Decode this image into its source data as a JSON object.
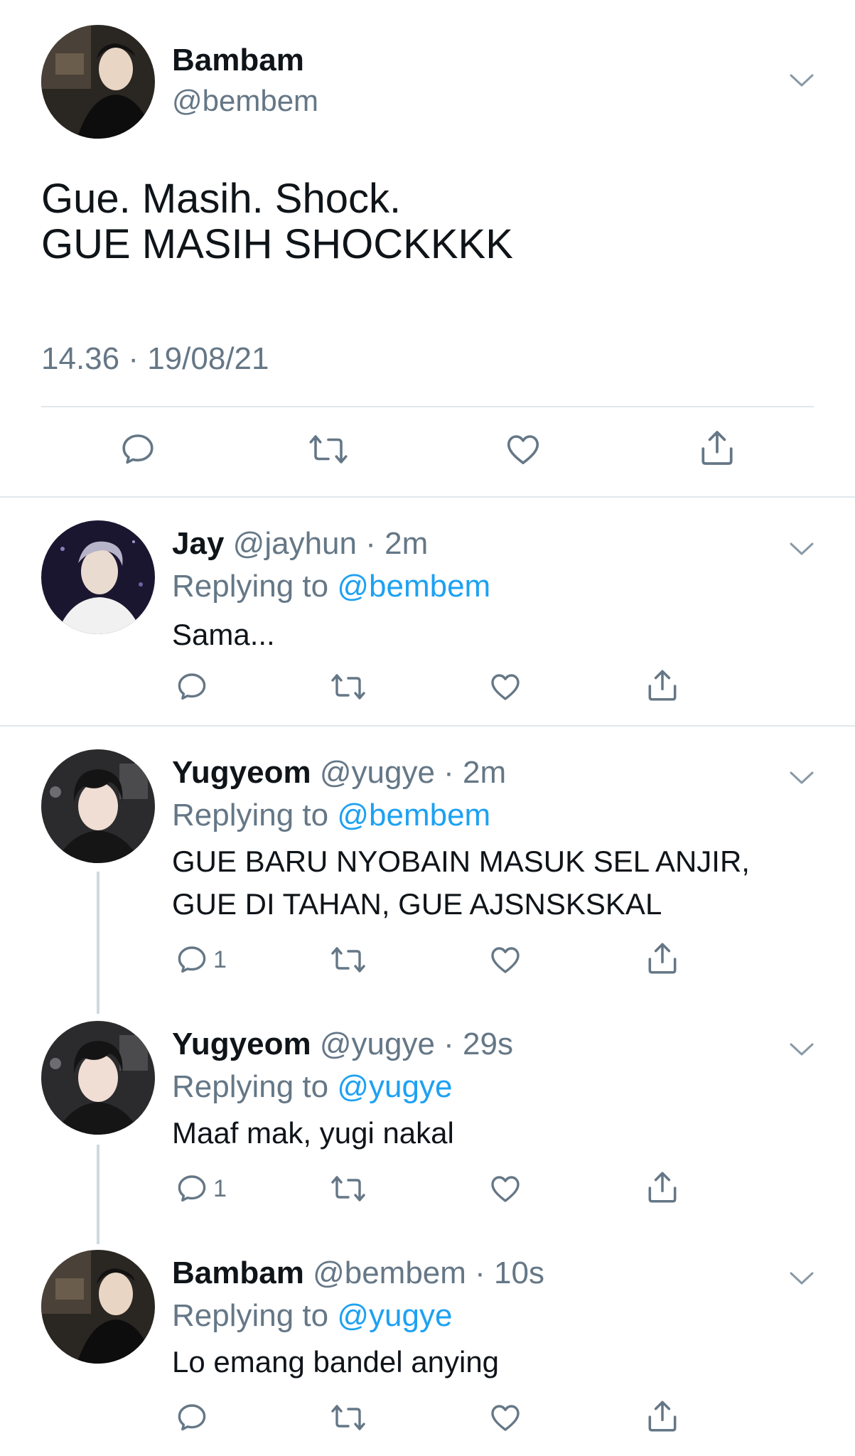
{
  "main_tweet": {
    "name": "Bambam",
    "handle": "@bembem",
    "text_lines": [
      "Gue. Masih. Shock.",
      "GUE MASIH SHOCKKKK"
    ],
    "timestamp": "14.36 · 19/08/21",
    "actions": [
      "reply-icon",
      "retweet-icon",
      "like-icon",
      "share-icon"
    ]
  },
  "replies": [
    {
      "name": "Jay",
      "handle": "@jayhun",
      "time": "· 2m",
      "replying_label": "Replying to ",
      "replying_to": "@bembem",
      "text_lines": [
        "Sama..."
      ],
      "reply_count": ""
    },
    {
      "name": "Yugyeom",
      "handle": "@yugye",
      "time": "· 2m",
      "replying_label": "Replying to ",
      "replying_to": "@bembem",
      "text_lines": [
        "GUE BARU NYOBAIN MASUK SEL ANJIR,",
        "GUE DI TAHAN, GUE AJSNSKSKAL"
      ],
      "reply_count": "1"
    },
    {
      "name": "Yugyeom",
      "handle": "@yugye",
      "time": "· 29s",
      "replying_label": "Replying to ",
      "replying_to": "@yugye",
      "text_lines": [
        "Maaf mak, yugi nakal"
      ],
      "reply_count": "1"
    },
    {
      "name": "Bambam",
      "handle": "@bembem",
      "time": "· 10s",
      "replying_label": "Replying to ",
      "replying_to": "@yugye",
      "text_lines": [
        "Lo emang bandel anying"
      ],
      "reply_count": ""
    }
  ],
  "colors": {
    "text": "#0f1419",
    "secondary": "#657786",
    "link": "#1da1f2",
    "divider": "#e1e8ed"
  }
}
